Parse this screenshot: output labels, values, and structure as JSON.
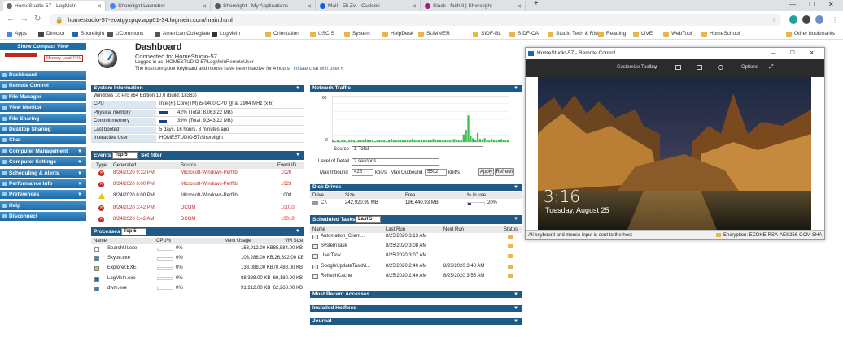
{
  "browser": {
    "tabs": [
      {
        "title": "HomeStudio-57 - LogMeIn",
        "color": "#666"
      },
      {
        "title": "Shorelight Launcher",
        "color": "#4285f4"
      },
      {
        "title": "Shorelight - My Applications",
        "color": "#555"
      },
      {
        "title": "Mail - Eli Zvi - Outlook",
        "color": "#0a64d8"
      },
      {
        "title": "Slack | faith.li | Shorelight",
        "color": "#a51d7b"
      }
    ],
    "new_tab": "+",
    "url": "homestudio-57-eoxtgyzpqv.app01-34.logmein.com/main.html",
    "bookmarks": [
      "Apps",
      "Director",
      "Shorelight",
      "UCommons",
      "American Collegiate",
      "LogMeIn",
      "Orientation",
      "USCIS",
      "System",
      "HelpDesk",
      "SUMMER",
      "SIDF-BL",
      "SIDF-CA",
      "Studio Tech & Risks",
      "Reading",
      "LIVE",
      "WebTool",
      "HomeSchool"
    ],
    "other_bookmarks": "Other bookmarks"
  },
  "sidebar": {
    "compact_label": "Show Compact View",
    "memory_label": "Memory Load 41%",
    "items": [
      "Dashboard",
      "Remote Control",
      "File Manager",
      "View Monitor",
      "File Sharing",
      "Desktop Sharing",
      "Chat",
      "Computer Management",
      "Computer Settings",
      "Scheduling & Alerts",
      "Performance Info",
      "Preferences",
      "Help",
      "Disconnect"
    ]
  },
  "header": {
    "title": "Dashboard",
    "connected": "Connected to: HomeStudio-57",
    "logged_in": "Logged in as: HOMESTUDIO-57\\LogMeInRemoteUser",
    "inactive": "The host computer keyboard and mouse have been inactive for 4 hours",
    "chat_link": "Initiate chat with user »"
  },
  "sysinfo": {
    "title": "System Information",
    "os": "Windows 10 Pro x64 Edition 10.0 (build: 18363)",
    "rows": [
      {
        "label": "CPU",
        "value": "Intel(R) Core(TM) i5-9400 CPU @ at 2904 MHz (x 6)",
        "bar": 0
      },
      {
        "label": "Physical memory",
        "value": "42% (Total: 8,063.22 MB)",
        "bar": 0.42
      },
      {
        "label": "Commit memory",
        "value": "39% (Total: 9,343.22 MB)",
        "bar": 0.39
      },
      {
        "label": "Last booted",
        "value": "5 days, 16 hours, 8 minutes ago",
        "bar": 0
      },
      {
        "label": "Interactive User",
        "value": "HOMESTUDIO-57\\Shorelight",
        "bar": 0
      }
    ]
  },
  "events": {
    "title": "Events",
    "top": "Top 5",
    "filter": "Set filter",
    "cols": [
      "Type",
      "Generated",
      "Source",
      "Event ID"
    ],
    "rows": [
      {
        "type": "error",
        "date": "8/24/2020 9:32 PM",
        "source": "Microsoft-Windows-Perflib",
        "id": "1020"
      },
      {
        "type": "error",
        "date": "8/24/2020 6:00 PM",
        "source": "Microsoft-Windows-Perflib",
        "id": "1023"
      },
      {
        "type": "warning",
        "date": "8/24/2020 6:00 PM",
        "source": "Microsoft-Windows-Perflib",
        "id": "1008"
      },
      {
        "type": "error",
        "date": "8/24/2020 3:42 PM",
        "source": "DCOM",
        "id": "10010"
      },
      {
        "type": "error",
        "date": "8/24/2020 3:42 AM",
        "source": "DCOM",
        "id": "10010"
      }
    ]
  },
  "processes": {
    "title": "Processes",
    "top": "Top 5",
    "cols": [
      "Name",
      "CPU%",
      "Mem Usage",
      "VM Size"
    ],
    "rows": [
      {
        "name": "SearchUI.exe",
        "cpu": "0%",
        "mem": "153,912.00 KB",
        "vm": "85,584.00 KB"
      },
      {
        "name": "Skype.exe",
        "cpu": "0%",
        "mem": "103,288.00 KB",
        "vm": "126,392.00 KB"
      },
      {
        "name": "Explorer.EXE",
        "cpu": "0%",
        "mem": "138,088.00 KB",
        "vm": "70,488.00 KB"
      },
      {
        "name": "LogMeIn.exe",
        "cpu": "0%",
        "mem": "88,388.00 KB",
        "vm": "69,180.00 KB"
      },
      {
        "name": "dwm.exe",
        "cpu": "0%",
        "mem": "91,212.00 KB",
        "vm": "62,268.00 KB"
      }
    ]
  },
  "network": {
    "title": "Network Traffic",
    "ymax": "60",
    "ymin": "0",
    "source_label": "Source",
    "source_value": "Σ Total",
    "detail_label": "Level of Detail",
    "detail_value": "2 seconds",
    "inbound_label": "Max Inbound",
    "inbound_value": "426",
    "unit": "kbit/s",
    "outbound_label": "Max Outbound",
    "outbound_value": "5502",
    "apply": "Apply",
    "refresh": "Refresh",
    "traffic": [
      2,
      1,
      2,
      1,
      3,
      2,
      1,
      2,
      3,
      2,
      1,
      3,
      2,
      2,
      4,
      2,
      3,
      2,
      1,
      2,
      3,
      2,
      2,
      1,
      3,
      4,
      2,
      3,
      2,
      3,
      2,
      2,
      3,
      2,
      4,
      3,
      2,
      3,
      2,
      3,
      2,
      2,
      3,
      4,
      3,
      2,
      3,
      2,
      3,
      2,
      2,
      3,
      4,
      3,
      2,
      3,
      10,
      16,
      35,
      8,
      5,
      3,
      12,
      4,
      3,
      5,
      3,
      2,
      4,
      3,
      2,
      3,
      4,
      3,
      2,
      3
    ]
  },
  "disk": {
    "title": "Disk Drives",
    "cols": [
      "Drive",
      "Size",
      "Free",
      "% in use"
    ],
    "rows": [
      {
        "drive": "C:\\",
        "size": "242,920.99 MB",
        "free": "196,440.93 MB",
        "pct": "20%",
        "fill": 0.2
      }
    ]
  },
  "tasks": {
    "title": "Scheduled Tasks",
    "top": "Last 5",
    "cols": [
      "Name",
      "Last Run",
      "Next Run",
      "Status"
    ],
    "rows": [
      {
        "name": "Automation_Client...",
        "last": "8/25/2020 3:13 AM",
        "next": ""
      },
      {
        "name": "SystemTask",
        "last": "8/25/2020 3:08 AM",
        "next": ""
      },
      {
        "name": "UserTask",
        "last": "8/25/2020 3:07 AM",
        "next": ""
      },
      {
        "name": "GoogleUpdateTaskM...",
        "last": "8/25/2020 2:40 AM",
        "next": "8/25/2020 3:40 AM"
      },
      {
        "name": "RefreshCache",
        "last": "8/25/2020 2:40 AM",
        "next": "8/25/2020 3:55 AM"
      }
    ]
  },
  "collapsed": [
    "Most Recent Accesses",
    "Installed Hotfixes",
    "Journal"
  ],
  "remote": {
    "title": "HomeStudio-57 - Remote Control",
    "toolbar": "Customize Toolbar",
    "options": "Options",
    "time": "3:16",
    "date": "Tuesday, August 25",
    "status": "All keyboard and mouse input is sent to the host",
    "encryption": "Encryption: ECDHE-RSA-AES256-GCM-SHA"
  }
}
